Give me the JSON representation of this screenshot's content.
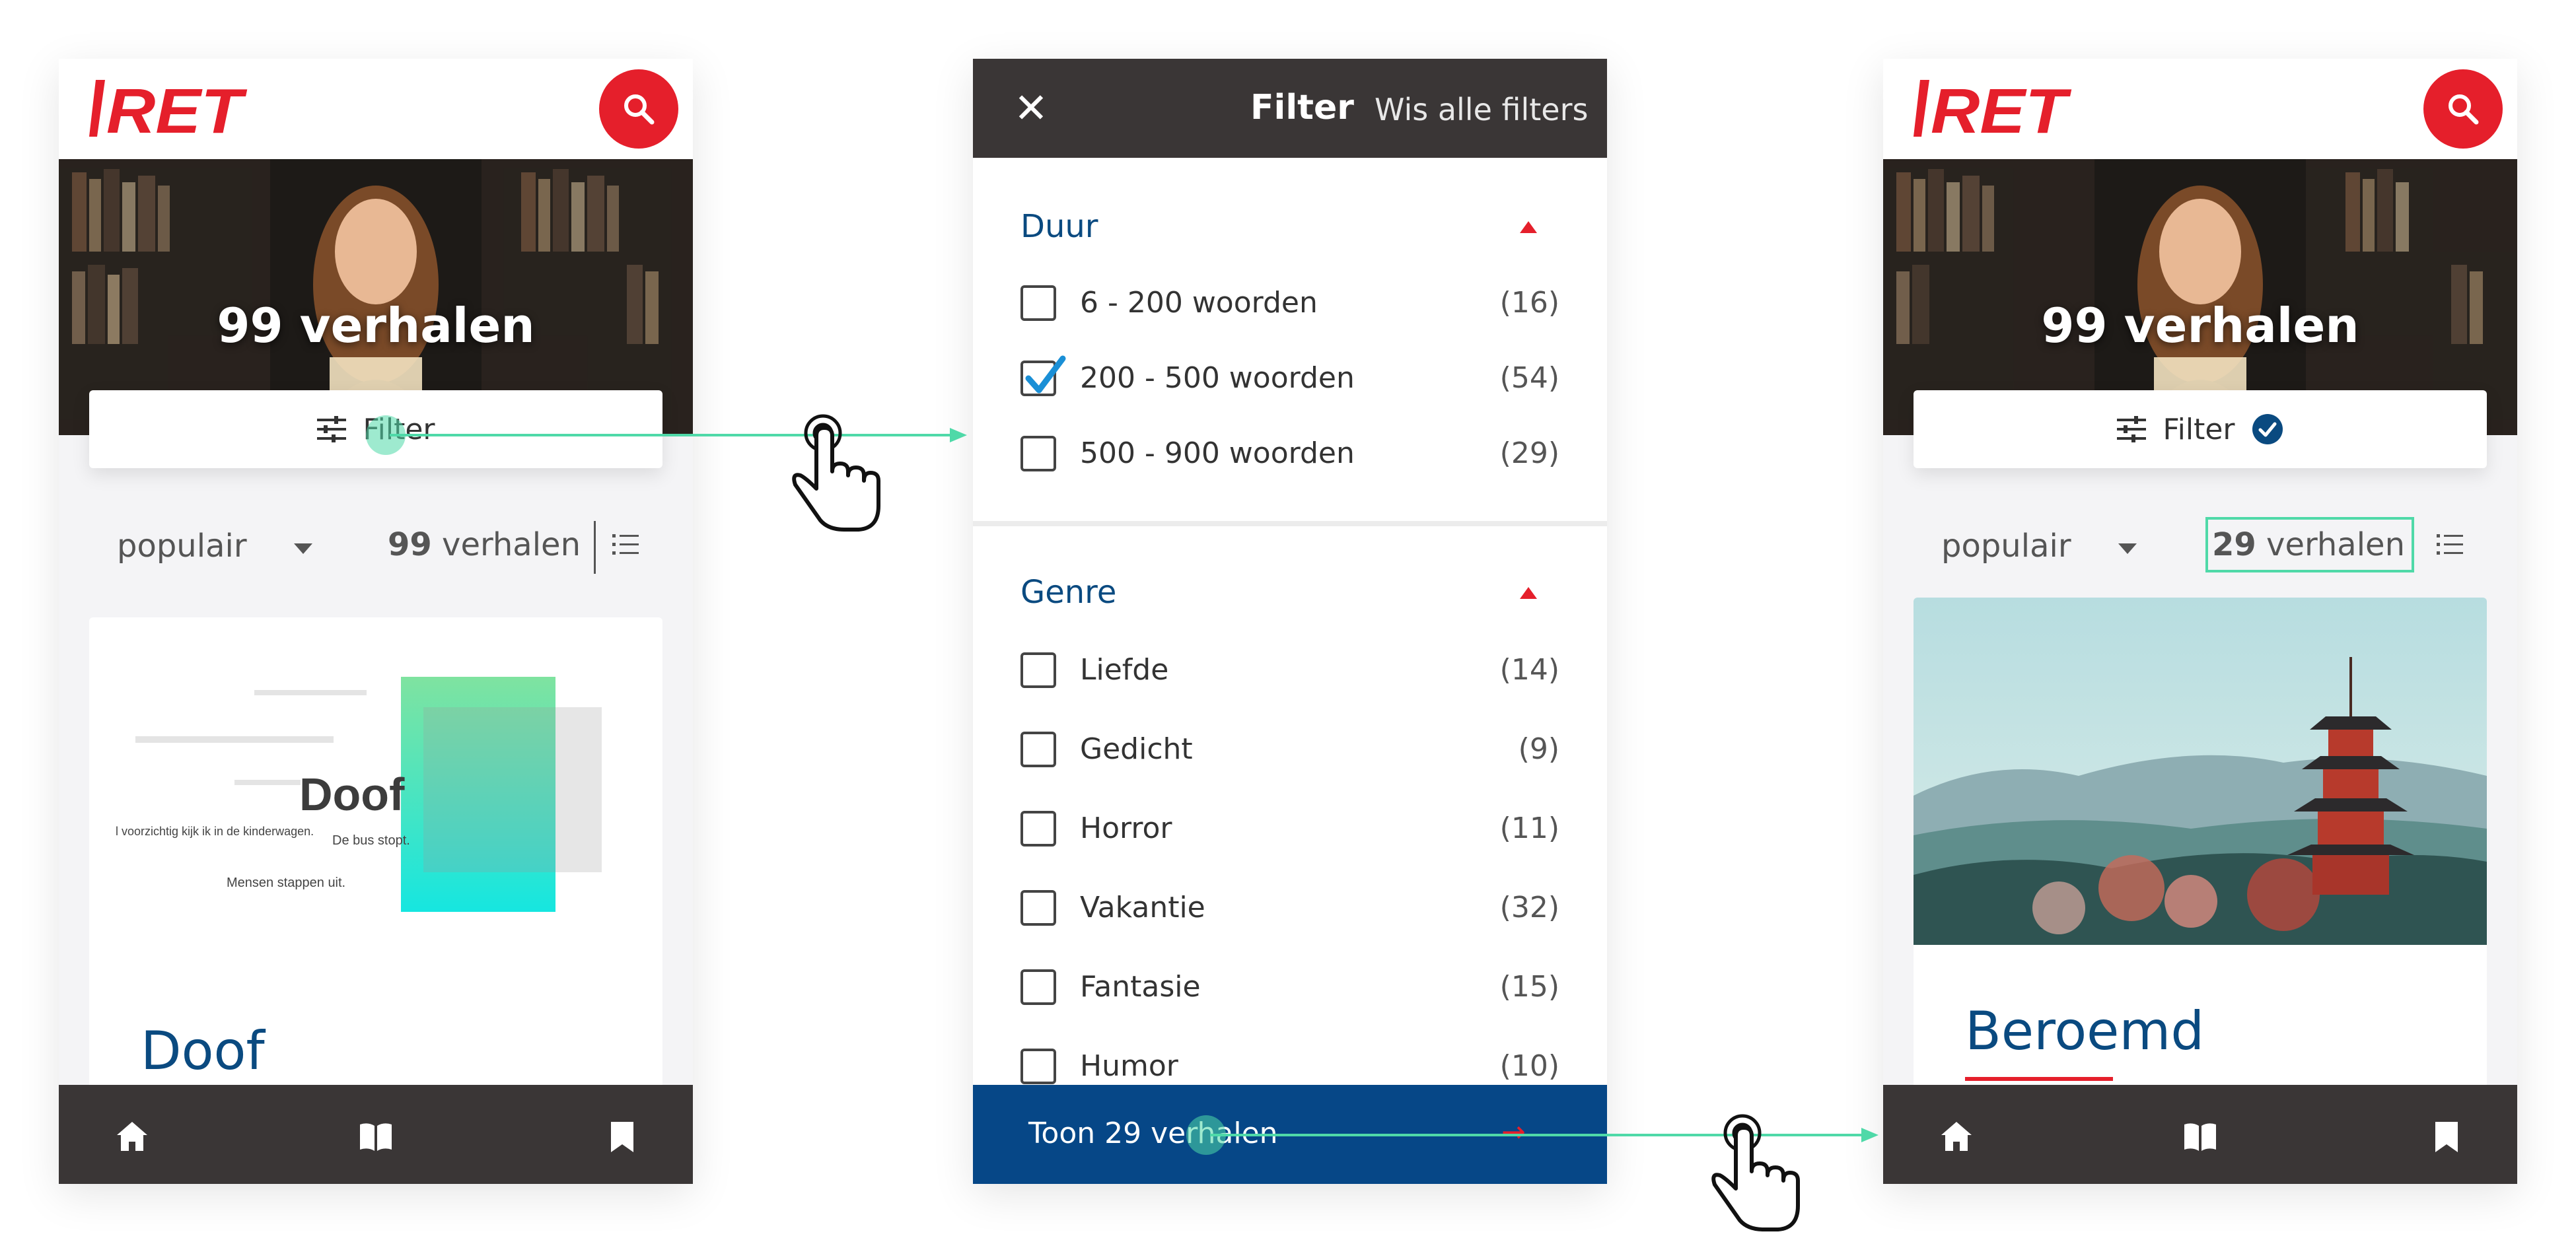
{
  "screen_list": {
    "hero_title": "99 verhalen",
    "filter_label": "Filter",
    "sort_label": "populair",
    "count_num": "99",
    "count_suffix": " verhalen",
    "card": {
      "title": "Doof",
      "thumb_title": "Doof",
      "thumb_lines": [
        "De bus stopt.",
        "Mensen stappen uit.",
        "l voorzichtig kijk ik in de kinderwagen."
      ]
    }
  },
  "screen_filter": {
    "title": "Filter",
    "clear_label": "Wis alle filters",
    "close_glyph": "✕",
    "sections": [
      {
        "name": "Duur",
        "options": [
          {
            "label": "6 - 200 woorden",
            "count": "(16)",
            "checked": false
          },
          {
            "label": "200 - 500 woorden",
            "count": "(54)",
            "checked": true
          },
          {
            "label": "500 - 900 woorden",
            "count": "(29)",
            "checked": false
          }
        ]
      },
      {
        "name": "Genre",
        "options": [
          {
            "label": "Liefde",
            "count": "(14)",
            "checked": false
          },
          {
            "label": "Gedicht",
            "count": "(9)",
            "checked": false
          },
          {
            "label": "Horror",
            "count": "(11)",
            "checked": false
          },
          {
            "label": "Vakantie",
            "count": "(32)",
            "checked": false
          },
          {
            "label": "Fantasie",
            "count": "(15)",
            "checked": false
          },
          {
            "label": "Humor",
            "count": "(10)",
            "checked": false
          }
        ]
      }
    ],
    "cta_label": "Toon 29 verhalen",
    "cta_arrow": "→"
  },
  "screen_result": {
    "hero_title": "99 verhalen",
    "filter_label": "Filter",
    "sort_label": "populair",
    "count_num": "29",
    "count_suffix": " verhalen",
    "card": {
      "title": "Beroemd"
    }
  },
  "colors": {
    "brand_red": "#e51f2b",
    "primary_blue": "#064787",
    "dark_bar": "#3a3636",
    "highlight_green": "#4fd9a8"
  },
  "icons": [
    "search-icon",
    "filter-sliders-icon",
    "list-view-icon",
    "home-icon",
    "book-icon",
    "bookmark-icon",
    "close-icon",
    "check-badge-icon",
    "tap-hand-icon"
  ]
}
